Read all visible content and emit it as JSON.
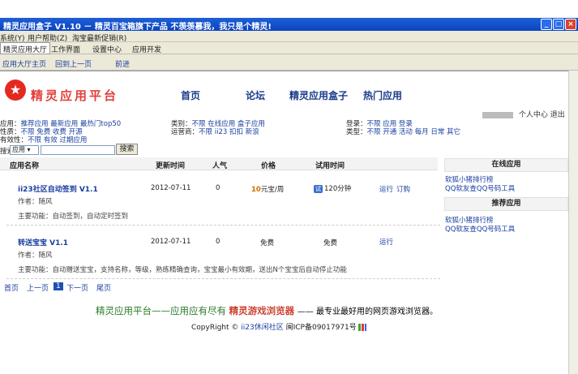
{
  "window": {
    "title": "精灵应用盒子 V1.10 － 精灵百宝箱旗下产品  不羡羡慕我，我只是个精灵!",
    "minimize": "_",
    "maximize": "□",
    "close": "×"
  },
  "menubar": [
    "系统(Y)",
    "用户帮助(Z)",
    "淘宝最新促销(R)"
  ],
  "tabs": [
    "精灵应用大厅",
    "工作界面",
    "设置中心",
    "应用开发"
  ],
  "subnav": [
    "应用大厅主页",
    "回到上一页",
    "前进"
  ],
  "logo_text": "精灵应用平台",
  "topnav": [
    "首页",
    "论坛",
    "精灵应用盒子",
    "热门应用"
  ],
  "user": {
    "center": "个人中心",
    "logout": "退出"
  },
  "filters": {
    "app_label": "应用：",
    "app_values": "推荐应用  最新应用  最热门top50",
    "type_label": "类别：",
    "type_values": "不限  在线应用  盒子应用",
    "login_label": "登录：",
    "login_values": "不限  应用  登录",
    "fee_label": "性质：",
    "fee_values": "不限  免费  收费  开源",
    "operator_label": "运营商：",
    "operator_values": "不限  ii23  扣扣  新浪",
    "kind_label": "类型：",
    "kind_values": "不限  开通  活动  每月  日常  其它",
    "valid_label": "有效性：",
    "valid_values": "不限  有效  过期应用"
  },
  "search": {
    "label": "搜索",
    "select": "应用",
    "button": "搜索"
  },
  "table": {
    "headers": [
      "应用名称",
      "更新时间",
      "人气",
      "价格",
      "试用时间"
    ],
    "rows": [
      {
        "name": "ii23社区自动签到 V1.1",
        "date": "2012-07-11",
        "popularity": "0",
        "price_num": "10",
        "price_unit": "元宝/周",
        "trial_icon": "试",
        "trial": "120分钟",
        "run": "运行",
        "order": "订购",
        "author": "作者：随风",
        "feature": "主要功能：自动签到，自动定时签到"
      },
      {
        "name": "转送宝宝 V1.1",
        "date": "2012-07-11",
        "popularity": "0",
        "price": "免费",
        "trial": "免费",
        "run": "运行",
        "author": "作者：随风",
        "feature": "主要功能：自动赠送宝宝，支持名称，等级，熟练精确查询，宝宝最小有效期，送出N个宝宝后自动停止功能"
      }
    ]
  },
  "sidebar": {
    "online_title": "在线应用",
    "online_links": [
      "软狐小猪排行榜",
      "QQ软友查QQ号码工具"
    ],
    "recommend_title": "推荐应用",
    "recommend_links": [
      "软狐小猪排行榜",
      "QQ软友查QQ号码工具"
    ]
  },
  "pager": {
    "first": "首页",
    "prev": "上一页",
    "current": "1",
    "next": "下一页",
    "last": "尾页"
  },
  "footer": {
    "part1": "精灵应用平台——应用应有尽有",
    "part2": "精灵游戏浏览器",
    "part3": "—— 最专业最好用的网页游戏浏览器。",
    "copy_prefix": "CopyRight ©",
    "copy_link": "ii23休闲社区",
    "icp": "闽ICP备09017971号"
  }
}
